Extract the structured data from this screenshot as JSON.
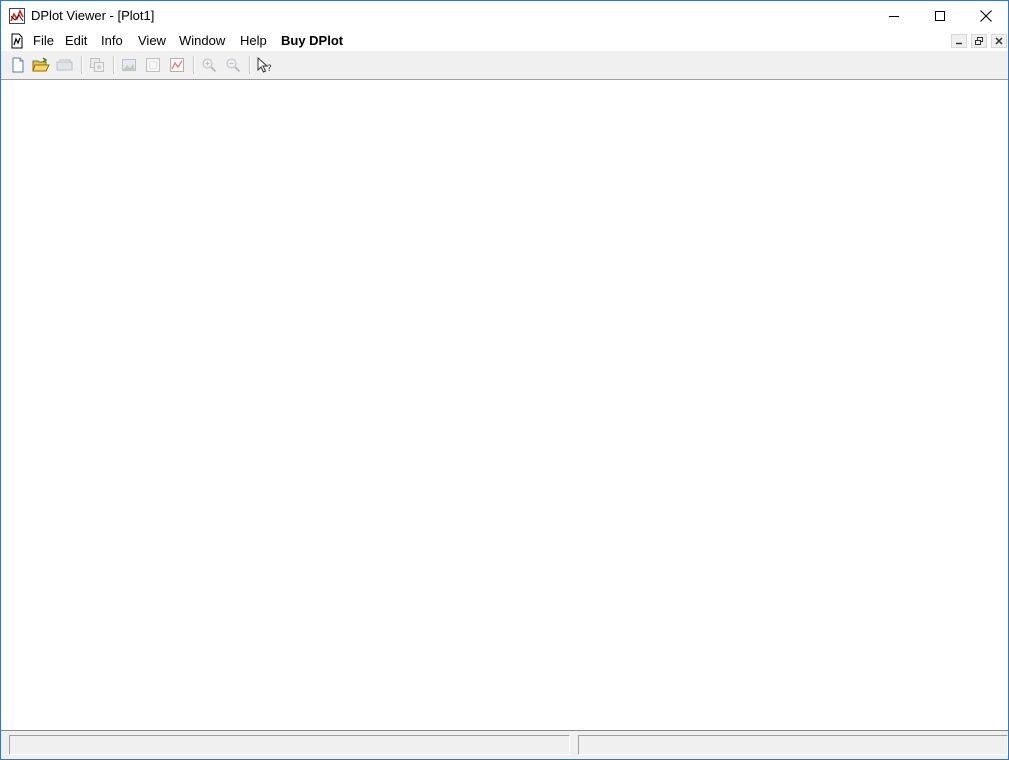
{
  "window": {
    "title": "DPlot Viewer - [Plot1]",
    "icon": "dplot-app-icon"
  },
  "window_controls": {
    "minimize_icon": "minimize-icon",
    "maximize_icon": "maximize-icon",
    "close_icon": "close-icon"
  },
  "menubar": {
    "doc_icon": "document-icon",
    "items": [
      {
        "label": "File"
      },
      {
        "label": "Edit"
      },
      {
        "label": "Info"
      },
      {
        "label": "View"
      },
      {
        "label": "Window"
      },
      {
        "label": "Help"
      },
      {
        "label": "Buy DPlot"
      }
    ],
    "mdi_controls": [
      "mdi-minimize-icon",
      "mdi-restore-icon",
      "mdi-close-icon"
    ]
  },
  "toolbar": {
    "buttons": [
      {
        "icon": "new-document-icon",
        "enabled": true
      },
      {
        "icon": "open-folder-icon",
        "enabled": true
      },
      {
        "icon": "open-recent-icon",
        "enabled": false
      },
      {
        "icon": "copy-image-icon",
        "enabled": false
      },
      {
        "icon": "picture-icon",
        "enabled": false
      },
      {
        "icon": "frame-icon",
        "enabled": false
      },
      {
        "icon": "chart-icon",
        "enabled": false
      },
      {
        "icon": "zoom-in-icon",
        "enabled": false
      },
      {
        "icon": "zoom-out-icon",
        "enabled": false
      },
      {
        "icon": "pointer-help-icon",
        "enabled": true
      }
    ]
  },
  "statusbar": {
    "panes": [
      "",
      ""
    ]
  },
  "colors": {
    "window_border": "#2b79c8",
    "toolbar_bg": "#f0f0f0",
    "client_bg": "#ffffff"
  }
}
